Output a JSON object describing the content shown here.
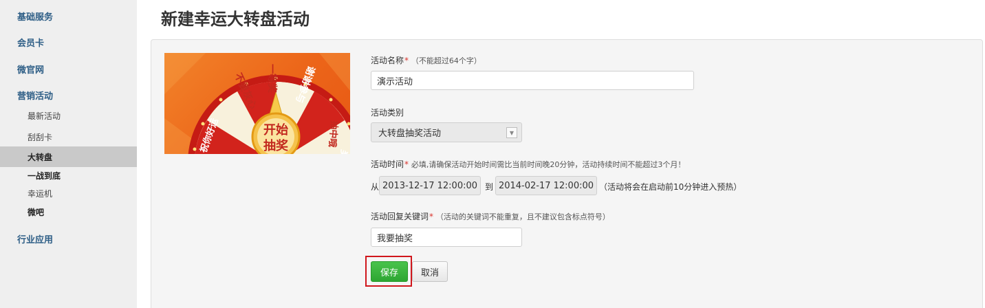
{
  "sidebar": {
    "items": [
      {
        "label": "基础服务",
        "type": "category"
      },
      {
        "label": "会员卡",
        "type": "category"
      },
      {
        "label": "微官网",
        "type": "category"
      },
      {
        "label": "营销活动",
        "type": "category"
      },
      {
        "label": "最新活动",
        "type": "sub"
      },
      {
        "label": "刮刮卡",
        "type": "sub"
      },
      {
        "label": "大转盘",
        "type": "sub",
        "active": true
      },
      {
        "label": "一战到底",
        "type": "sub"
      },
      {
        "label": "幸运机",
        "type": "sub"
      },
      {
        "label": "微吧",
        "type": "sub"
      },
      {
        "label": "行业应用",
        "type": "category"
      }
    ]
  },
  "page": {
    "title": "新建幸运大转盘活动"
  },
  "banner": {
    "wheel_center_line1": "开始",
    "wheel_center_line2": "抽奖",
    "segment_first_prize": "一等奖",
    "segment_thanks": "谢谢参与",
    "segment_dont_lose_heart": "不要灰心",
    "segment_partial_right": "抽中哦",
    "segment_partial_left": "祝你好运",
    "segment_partial_bottom_right": "奖"
  },
  "form": {
    "name": {
      "label": "活动名称",
      "required_mark": "*",
      "hint": "（不能超过64个字）",
      "value": "演示活动"
    },
    "type": {
      "label": "活动类别",
      "selected": "大转盘抽奖活动",
      "arrow_icon": "dropdown-arrow-icon"
    },
    "time": {
      "label": "活动时间",
      "required_mark": "*",
      "hint": "必填,请确保活动开始时间需比当前时间晚20分钟，活动持续时间不能超过3个月！",
      "from_label": "从",
      "start": "2013-12-17 12:00:00",
      "to_label": "到",
      "end": "2014-02-17 12:00:00",
      "note": "（活动将会在启动前10分钟进入预热）"
    },
    "keyword": {
      "label": "活动回复关键词",
      "required_mark": "*",
      "hint": "（活动的关键词不能重复，且不建议包含标点符号）",
      "value": "我要抽奖"
    },
    "buttons": {
      "save": "保存",
      "cancel": "取消"
    }
  },
  "colors": {
    "nav_category": "#2e5e86",
    "save_button": "#36ad38",
    "highlight_border": "#d0161c",
    "required": "#d9332c",
    "banner_orange": "#ec6519",
    "wheel_red": "#d2231c"
  }
}
